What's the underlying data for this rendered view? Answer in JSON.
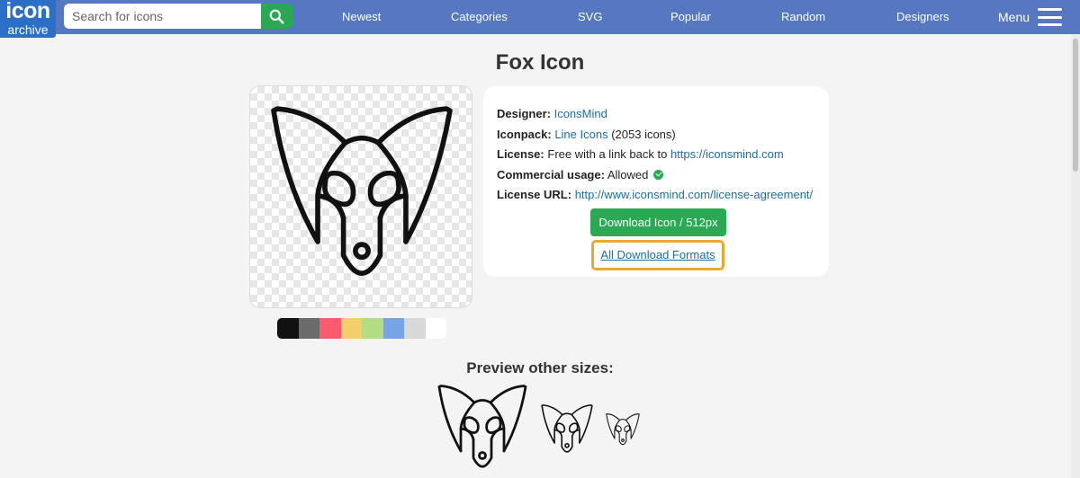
{
  "header": {
    "logo_line1": "icon",
    "logo_line2": "archive",
    "search_placeholder": "Search for icons",
    "nav": [
      "Newest",
      "Categories",
      "SVG",
      "Popular",
      "Random",
      "Designers"
    ],
    "menu_label": "Menu"
  },
  "page": {
    "title": "Fox Icon"
  },
  "info": {
    "designer_label": "Designer:",
    "designer_value": "IconsMind",
    "iconpack_label": "Iconpack:",
    "iconpack_value": "Line Icons",
    "iconpack_count": "(2053 icons)",
    "license_label": "License:",
    "license_text": "Free with a link back to",
    "license_link": "https://iconsmind.com",
    "commercial_label": "Commercial usage:",
    "commercial_value": "Allowed",
    "license_url_label": "License URL:",
    "license_url_value": "http://www.iconsmind.com/license-agreement/",
    "download_button": "Download Icon / 512px",
    "formats_button": "All Download Formats"
  },
  "swatch_colors": [
    "#111111",
    "#6b6b6b",
    "#ff5a6e",
    "#f3cf6c",
    "#b3dd82",
    "#77a4e2",
    "#d8d8d8",
    "#ffffff"
  ],
  "colors": {
    "header_bg": "#5578c0",
    "logo_bg": "#2b6fc7",
    "accent_green": "#2aa853",
    "link": "#1a6ea8",
    "focus_outline": "#e9a92a"
  },
  "sizes_title": "Preview other sizes:",
  "icon_name": "fox-icon"
}
